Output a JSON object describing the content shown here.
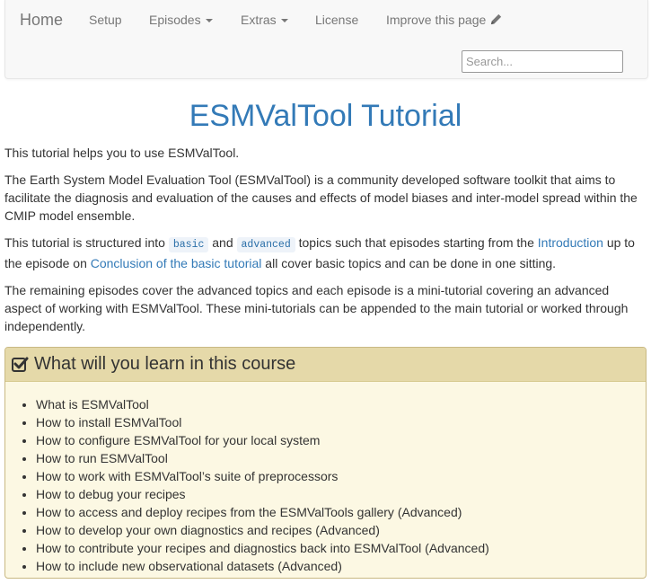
{
  "nav": {
    "brand": "Home",
    "items": [
      {
        "label": "Setup"
      },
      {
        "label": "Episodes"
      },
      {
        "label": "Extras"
      },
      {
        "label": "License"
      },
      {
        "label": "Improve this page"
      }
    ],
    "search_placeholder": "Search..."
  },
  "page": {
    "title": "ESMValTool Tutorial",
    "para1": "This tutorial helps you to use ESMValTool.",
    "para2": "The Earth System Model Evaluation Tool (ESMValTool) is a community developed software toolkit that aims to facilitate the diagnosis and evaluation of the causes and effects of model biases and inter-model spread within the CMIP model ensemble.",
    "para3": {
      "t1": "This tutorial is structured into ",
      "code1": "basic",
      "t2": " and ",
      "code2": "advanced",
      "t3": " topics such that episodes starting from the ",
      "link1": "Introduction",
      "t4": " up to the episode on ",
      "link2": "Conclusion of the basic tutorial",
      "t5": " all cover basic topics and can be done in one sitting."
    },
    "para4": "The remaining episodes cover the advanced topics and each episode is a mini-tutorial covering an advanced aspect of working with ESMValTool. These mini-tutorials can be appended to the main tutorial or worked through independently."
  },
  "objectives": {
    "title": "What will you learn in this course",
    "icon": "check-square-icon",
    "items": [
      "What is ESMValTool",
      "How to install ESMValTool",
      "How to configure ESMValTool for your local system",
      "How to run ESMValTool",
      "How to work with ESMValTool’s suite of preprocessors",
      "How to debug your recipes",
      "How to access and deploy recipes from the ESMValTools gallery (Advanced)",
      "How to develop your own diagnostics and recipes (Advanced)",
      "How to contribute your recipes and diagnostics back into ESMValTool (Advanced)",
      "How to include new observational datasets (Advanced)"
    ]
  },
  "colors": {
    "link": "#337ab7",
    "objectives_header": "#e5d9a9",
    "objectives_body": "#fcf8e3"
  }
}
